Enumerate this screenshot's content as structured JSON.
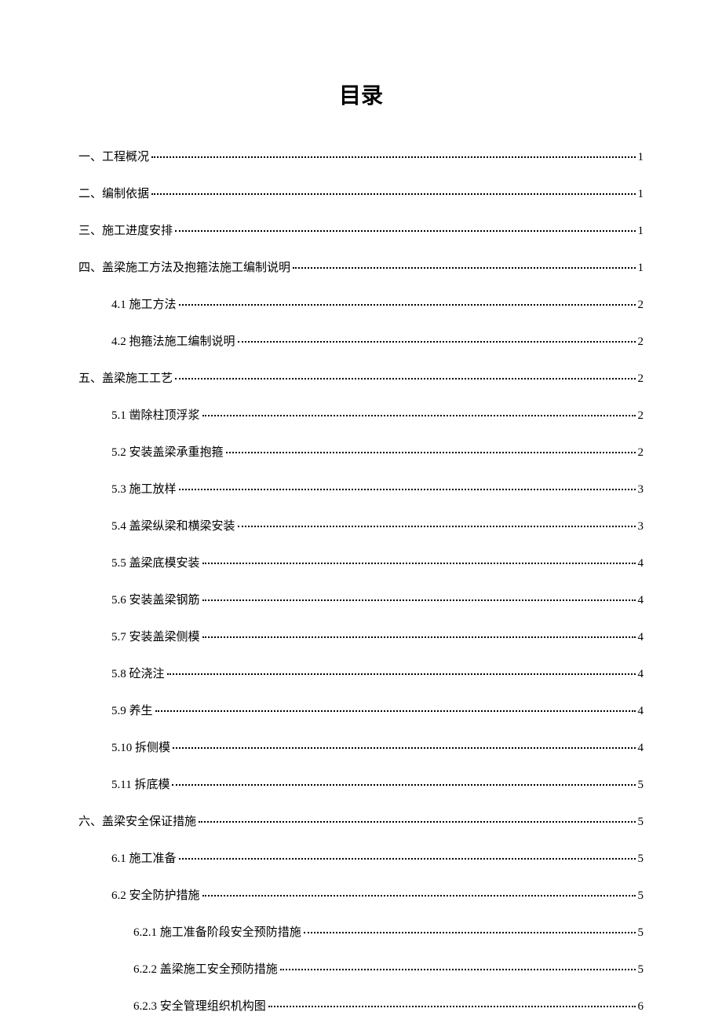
{
  "title": "目录",
  "entries": [
    {
      "level": 1,
      "text": "一、工程概况",
      "page": "1"
    },
    {
      "level": 1,
      "text": "二、编制依据",
      "page": "1"
    },
    {
      "level": 1,
      "text": "三、施工进度安排",
      "page": "1"
    },
    {
      "level": 1,
      "text": "四、盖梁施工方法及抱箍法施工编制说明",
      "page": "1"
    },
    {
      "level": 2,
      "text": "4.1 施工方法",
      "page": "2"
    },
    {
      "level": 2,
      "text": "4.2 抱箍法施工编制说明",
      "page": "2"
    },
    {
      "level": 1,
      "text": "五、盖梁施工工艺",
      "page": "2"
    },
    {
      "level": 2,
      "text": "5.1 凿除柱顶浮浆",
      "page": "2"
    },
    {
      "level": 2,
      "text": "5.2 安装盖梁承重抱箍",
      "page": "2"
    },
    {
      "level": 2,
      "text": "5.3 施工放样",
      "page": "3"
    },
    {
      "level": 2,
      "text": "5.4 盖梁纵梁和横梁安装",
      "page": "3"
    },
    {
      "level": 2,
      "text": "5.5 盖梁底模安装",
      "page": "4"
    },
    {
      "level": 2,
      "text": "5.6 安装盖梁钢筋",
      "page": "4"
    },
    {
      "level": 2,
      "text": "5.7 安装盖梁侧模",
      "page": "4"
    },
    {
      "level": 2,
      "text": "5.8 砼浇注",
      "page": "4"
    },
    {
      "level": 2,
      "text": "5.9 养生",
      "page": "4"
    },
    {
      "level": 2,
      "text": "5.10 拆侧模",
      "page": "4"
    },
    {
      "level": 2,
      "text": "5.11 拆底模",
      "page": "5"
    },
    {
      "level": 1,
      "text": "六、盖梁安全保证措施",
      "page": "5"
    },
    {
      "level": 2,
      "text": "6.1 施工准备",
      "page": "5"
    },
    {
      "level": 2,
      "text": "6.2 安全防护措施",
      "page": "5"
    },
    {
      "level": 3,
      "text": "6.2.1 施工准备阶段安全预防措施",
      "page": "5"
    },
    {
      "level": 3,
      "text": "6.2.2 盖梁施工安全预防措施",
      "page": "5"
    },
    {
      "level": 3,
      "text": "6.2.3 安全管理组织机构图",
      "page": "6"
    }
  ]
}
